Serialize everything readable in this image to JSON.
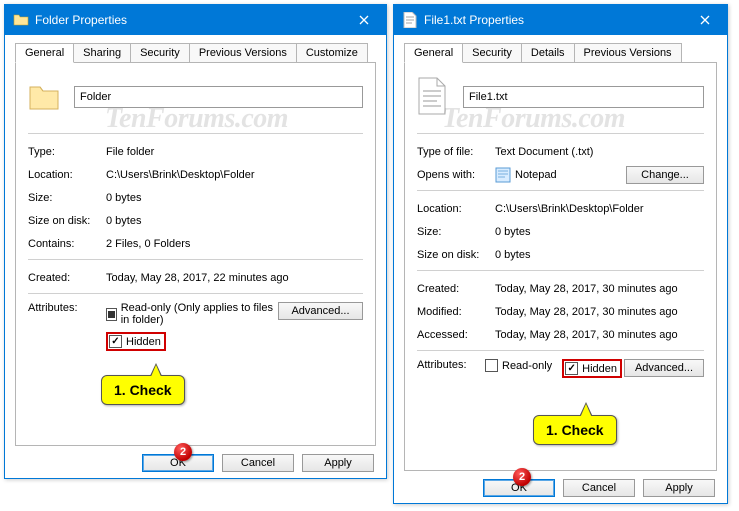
{
  "watermark": "TenForums.com",
  "dialog1": {
    "title": "Folder Properties",
    "tabs": [
      "General",
      "Sharing",
      "Security",
      "Previous Versions",
      "Customize"
    ],
    "name_value": "Folder",
    "rows": {
      "type": {
        "label": "Type:",
        "value": "File folder"
      },
      "location": {
        "label": "Location:",
        "value": "C:\\Users\\Brink\\Desktop\\Folder"
      },
      "size": {
        "label": "Size:",
        "value": "0 bytes"
      },
      "size_on_disk": {
        "label": "Size on disk:",
        "value": "0 bytes"
      },
      "contains": {
        "label": "Contains:",
        "value": "2 Files, 0 Folders"
      },
      "created": {
        "label": "Created:",
        "value": "Today, May 28, 2017, 22 minutes ago"
      },
      "attributes_label": "Attributes:",
      "readonly": "Read-only (Only applies to files in folder)",
      "hidden": "Hidden",
      "advanced": "Advanced..."
    },
    "buttons": {
      "ok": "OK",
      "cancel": "Cancel",
      "apply": "Apply"
    }
  },
  "dialog2": {
    "title": "File1.txt Properties",
    "tabs": [
      "General",
      "Security",
      "Details",
      "Previous Versions"
    ],
    "name_value": "File1.txt",
    "rows": {
      "type_of_file": {
        "label": "Type of file:",
        "value": "Text Document (.txt)"
      },
      "opens_with": {
        "label": "Opens with:",
        "value": "Notepad",
        "change": "Change..."
      },
      "location": {
        "label": "Location:",
        "value": "C:\\Users\\Brink\\Desktop\\Folder"
      },
      "size": {
        "label": "Size:",
        "value": "0 bytes"
      },
      "size_on_disk": {
        "label": "Size on disk:",
        "value": "0 bytes"
      },
      "created": {
        "label": "Created:",
        "value": "Today, May 28, 2017, 30 minutes ago"
      },
      "modified": {
        "label": "Modified:",
        "value": "Today, May 28, 2017, 30 minutes ago"
      },
      "accessed": {
        "label": "Accessed:",
        "value": "Today, May 28, 2017, 30 minutes ago"
      },
      "attributes_label": "Attributes:",
      "readonly": "Read-only",
      "hidden": "Hidden",
      "advanced": "Advanced..."
    },
    "buttons": {
      "ok": "OK",
      "cancel": "Cancel",
      "apply": "Apply"
    }
  },
  "annotations": {
    "check": "1. Check",
    "step2": "2"
  }
}
